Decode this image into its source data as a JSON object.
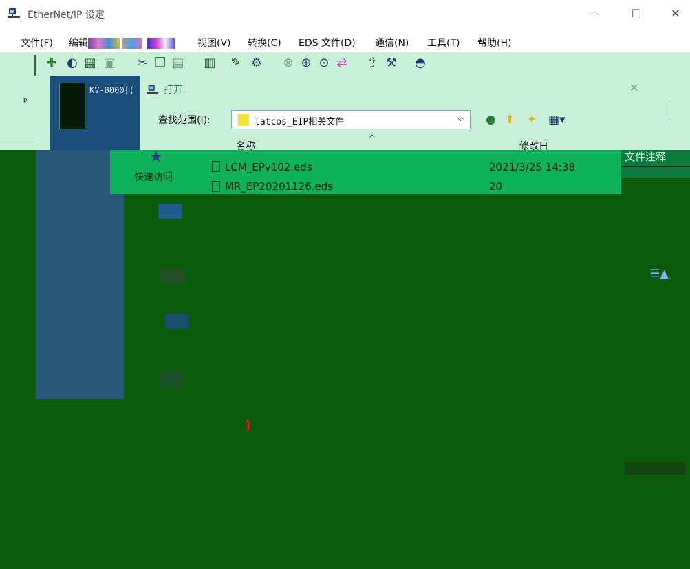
{
  "window": {
    "title": "EtherNet/IP 设定",
    "minimize_glyph": "—",
    "maximize_glyph": "☐",
    "close_glyph": "✕",
    "icon": "network-computer-icon"
  },
  "menu": {
    "items": [
      {
        "label": "文件(F)"
      },
      {
        "label": "编辑"
      },
      {
        "label": "视图(V)"
      },
      {
        "label": "转换(C)"
      },
      {
        "label": "EDS 文件(D)"
      },
      {
        "label": "通信(N)"
      },
      {
        "label": "工具(T)"
      },
      {
        "label": "帮助(H)"
      }
    ]
  },
  "toolbar": {
    "icons": [
      "add-device-icon",
      "online-icon",
      "network-icon",
      "device-icon",
      "cut-icon",
      "copy-icon",
      "paste-icon",
      "network-config-icon",
      "edit-icon",
      "properties-icon",
      "disconnect-icon",
      "search-icon",
      "monitor-icon",
      "transfer-icon",
      "upload-icon",
      "settings-icon",
      "help-icon"
    ]
  },
  "device_panel": {
    "pin_glyph": "ᵖ",
    "label": "KV-8000[("
  },
  "filenote_column": {
    "label": "文件注释"
  },
  "dialog": {
    "title": "打开",
    "close_glyph": "✕",
    "lookin_label": "查找范围(I):",
    "lookin_value": "latcos_EIP相关文件",
    "combo_arrow": "⌵",
    "nav_icons": [
      "back-icon",
      "up-folder-icon",
      "new-folder-icon",
      "view-menu-icon"
    ],
    "columns": {
      "name": "名称",
      "date": "修改日"
    },
    "sort_glyph": "^",
    "quick_access": "快速访问",
    "files": [
      {
        "name": "LCM_EPv102.eds",
        "date": "2021/3/25 14:38"
      },
      {
        "name": "MR_EP20201126.eds",
        "date": "20"
      }
    ]
  },
  "colors": {
    "body_green": "#0d5c0d",
    "dialog_mint": "#c8f0d8",
    "list_green": "#0eb25a",
    "device_blue": "#1b4e7a"
  }
}
